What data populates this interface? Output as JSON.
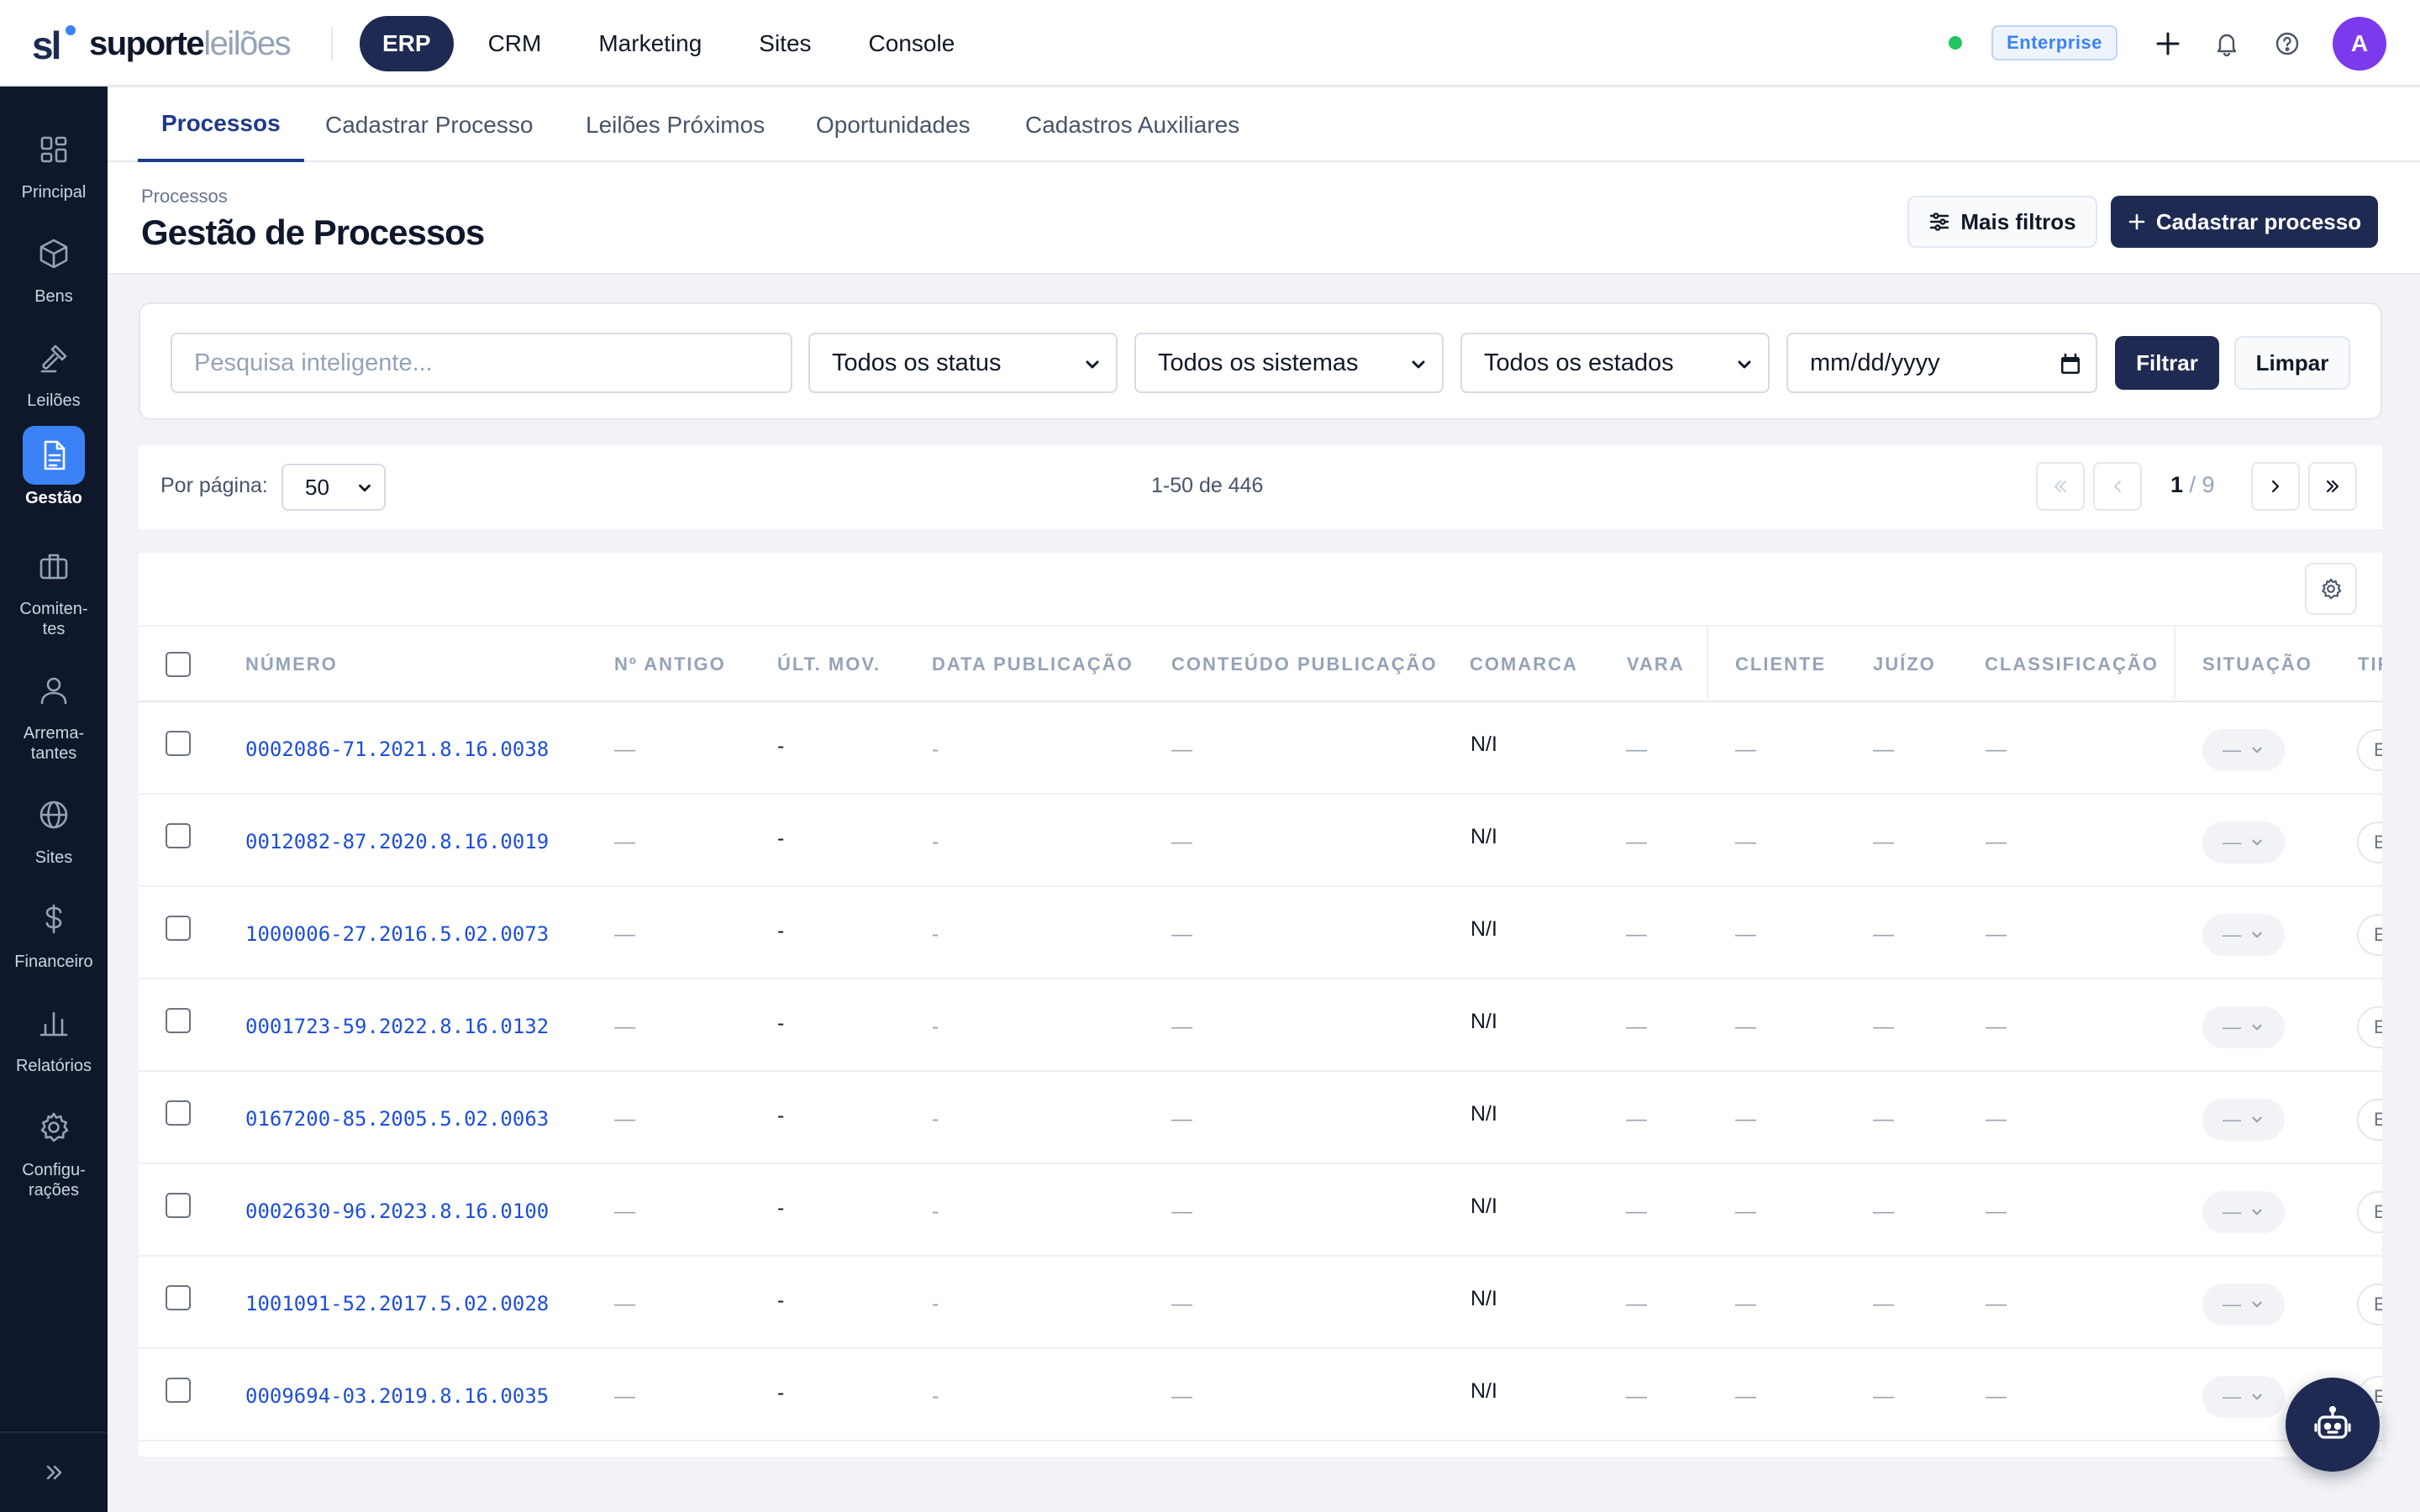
{
  "brand": {
    "name_bold": "suporte",
    "name_light": "leilões",
    "mark": "sl"
  },
  "topnav": [
    {
      "label": "ERP",
      "active": true
    },
    {
      "label": "CRM",
      "active": false
    },
    {
      "label": "Marketing",
      "active": false
    },
    {
      "label": "Sites",
      "active": false
    },
    {
      "label": "Console",
      "active": false
    }
  ],
  "status": {
    "online_color": "#22c55e"
  },
  "plan_badge": "Enterprise",
  "topbar_icons": [
    "plus-icon",
    "bell-icon",
    "help-icon"
  ],
  "user": {
    "avatar_initial": "A",
    "avatar_color": "#7c3aed"
  },
  "sidebar": {
    "items": [
      {
        "label": "Principal",
        "icon": "dashboard-icon",
        "active": false
      },
      {
        "label": "Bens",
        "icon": "box-icon",
        "active": false
      },
      {
        "label": "Leilões",
        "icon": "gavel-icon",
        "active": false
      },
      {
        "label": "Gestão",
        "icon": "document-icon",
        "active": true
      },
      {
        "label": "Comiten-\ntes",
        "icon": "briefcase-icon",
        "active": false
      },
      {
        "label": "Arrema-\ntantes",
        "icon": "user-icon",
        "active": false
      },
      {
        "label": "Sites",
        "icon": "globe-icon",
        "active": false
      },
      {
        "label": "Financeiro",
        "icon": "dollar-icon",
        "active": false
      },
      {
        "label": "Relatórios",
        "icon": "bar-chart-icon",
        "active": false
      },
      {
        "label": "Configu-\nrações",
        "icon": "gear-icon",
        "active": false
      }
    ],
    "collapse_icon": "chevrons-right-icon"
  },
  "tabs": [
    {
      "label": "Processos",
      "active": true
    },
    {
      "label": "Cadastrar Processo",
      "active": false
    },
    {
      "label": "Leilões Próximos",
      "active": false
    },
    {
      "label": "Oportunidades",
      "active": false
    },
    {
      "label": "Cadastros Auxiliares",
      "active": false
    }
  ],
  "header": {
    "breadcrumb": "Processos",
    "title": "Gestão de Processos",
    "more_filters": "Mais filtros",
    "create_button": "Cadastrar processo"
  },
  "filters": {
    "search_placeholder": "Pesquisa inteligente...",
    "status_select": "Todos os status",
    "system_select": "Todos os sistemas",
    "state_select": "Todos os estados",
    "date_placeholder": "mm/dd/yyyy",
    "apply": "Filtrar",
    "clear": "Limpar"
  },
  "pagination": {
    "per_page_label": "Por página:",
    "per_page_value": "50",
    "range": "1-50 de 446",
    "current_page": "1",
    "total_pages": "/ 9"
  },
  "table": {
    "columns": [
      "NÚMERO",
      "Nº ANTIGO",
      "ÚLT. MOV.",
      "DATA PUBLICAÇÃO",
      "CONTEÚDO PUBLICAÇÃO",
      "COMARCA",
      "VARA",
      "CLIENTE",
      "JUÍZO",
      "CLASSIFICAÇÃO",
      "SITUAÇÃO",
      "TIP"
    ],
    "rows": [
      {
        "numero": "0002086-71.2021.8.16.0038",
        "antigo": "—",
        "ult_mov": "-",
        "data_pub": "-",
        "conteudo": "—",
        "comarca": "N/I",
        "vara": "—",
        "cliente": "—",
        "juizo": "—",
        "classificacao": "—",
        "situacao": "—",
        "tipo": "E"
      },
      {
        "numero": "0012082-87.2020.8.16.0019",
        "antigo": "—",
        "ult_mov": "-",
        "data_pub": "-",
        "conteudo": "—",
        "comarca": "N/I",
        "vara": "—",
        "cliente": "—",
        "juizo": "—",
        "classificacao": "—",
        "situacao": "—",
        "tipo": "E"
      },
      {
        "numero": "1000006-27.2016.5.02.0073",
        "antigo": "—",
        "ult_mov": "-",
        "data_pub": "-",
        "conteudo": "—",
        "comarca": "N/I",
        "vara": "—",
        "cliente": "—",
        "juizo": "—",
        "classificacao": "—",
        "situacao": "—",
        "tipo": "E"
      },
      {
        "numero": "0001723-59.2022.8.16.0132",
        "antigo": "—",
        "ult_mov": "-",
        "data_pub": "-",
        "conteudo": "—",
        "comarca": "N/I",
        "vara": "—",
        "cliente": "—",
        "juizo": "—",
        "classificacao": "—",
        "situacao": "—",
        "tipo": "E"
      },
      {
        "numero": "0167200-85.2005.5.02.0063",
        "antigo": "—",
        "ult_mov": "-",
        "data_pub": "-",
        "conteudo": "—",
        "comarca": "N/I",
        "vara": "—",
        "cliente": "—",
        "juizo": "—",
        "classificacao": "—",
        "situacao": "—",
        "tipo": "E"
      },
      {
        "numero": "0002630-96.2023.8.16.0100",
        "antigo": "—",
        "ult_mov": "-",
        "data_pub": "-",
        "conteudo": "—",
        "comarca": "N/I",
        "vara": "—",
        "cliente": "—",
        "juizo": "—",
        "classificacao": "—",
        "situacao": "—",
        "tipo": "E"
      },
      {
        "numero": "1001091-52.2017.5.02.0028",
        "antigo": "—",
        "ult_mov": "-",
        "data_pub": "-",
        "conteudo": "—",
        "comarca": "N/I",
        "vara": "—",
        "cliente": "—",
        "juizo": "—",
        "classificacao": "—",
        "situacao": "—",
        "tipo": "E"
      },
      {
        "numero": "0009694-03.2019.8.16.0035",
        "antigo": "—",
        "ult_mov": "-",
        "data_pub": "-",
        "conteudo": "—",
        "comarca": "N/I",
        "vara": "—",
        "cliente": "—",
        "juizo": "—",
        "classificacao": "—",
        "situacao": "—",
        "tipo": "E"
      }
    ]
  },
  "assistant_button": {
    "icon": "robot-icon"
  },
  "colors": {
    "primary": "#1e2a52",
    "accent": "#3b82f6",
    "sidebar_bg": "#0f172a",
    "link": "#1d4ed8"
  }
}
